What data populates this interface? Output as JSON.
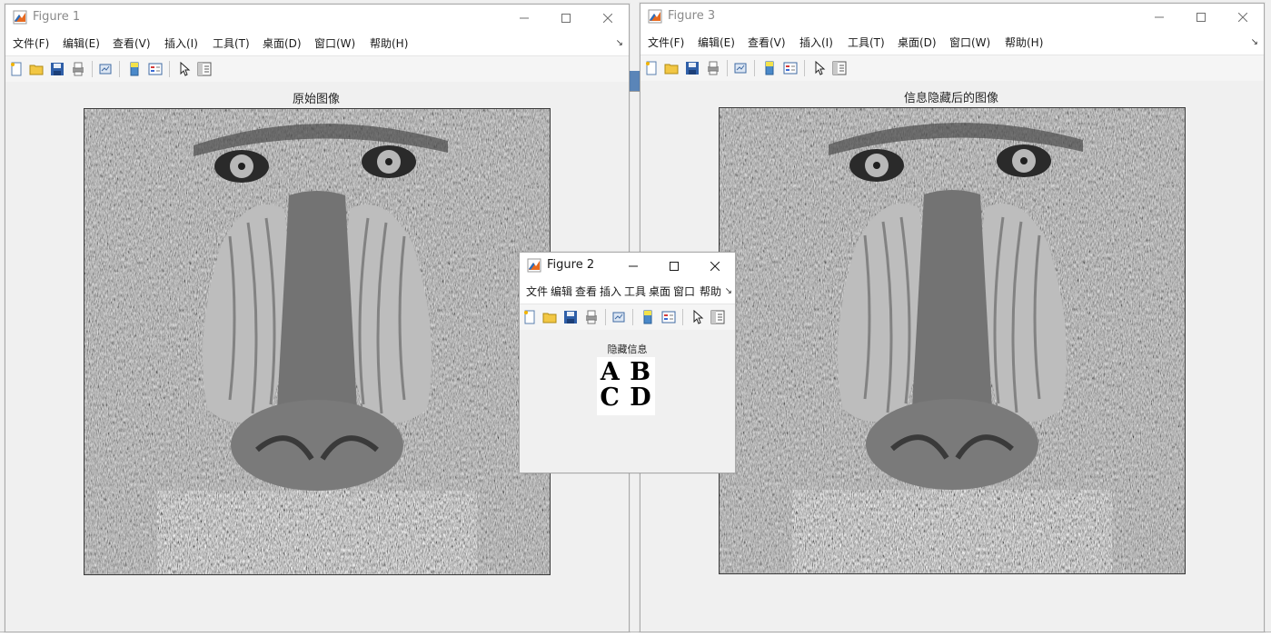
{
  "figure1": {
    "title": "Figure 1",
    "menus": [
      "文件(F)",
      "编辑(E)",
      "查看(V)",
      "插入(I)",
      "工具(T)",
      "桌面(D)",
      "窗口(W)",
      "帮助(H)"
    ],
    "axes_title": "原始图像"
  },
  "figure3": {
    "title": "Figure 3",
    "menus": [
      "文件(F)",
      "编辑(E)",
      "查看(V)",
      "插入(I)",
      "工具(T)",
      "桌面(D)",
      "窗口(W)",
      "帮助(H)"
    ],
    "axes_title": "信息隐藏后的图像"
  },
  "figure2": {
    "title": "Figure 2",
    "menus": [
      "文件",
      "编辑",
      "查看",
      "插入",
      "工具",
      "桌面",
      "窗口",
      "帮助"
    ],
    "axes_title": "隐藏信息",
    "hidden_text": [
      "A B",
      "C D"
    ]
  },
  "toolbar_icons": [
    "new-figure-icon",
    "open-file-icon",
    "save-figure-icon",
    "print-figure-icon",
    "link-plot-icon",
    "insert-colorbar-icon",
    "insert-legend-icon",
    "edit-plot-icon",
    "open-property-inspector-icon"
  ],
  "colors": {
    "titlebar_bg": "#ffffff",
    "figure_bg": "#f0f0f0",
    "title_text": "#8a8a8a"
  }
}
